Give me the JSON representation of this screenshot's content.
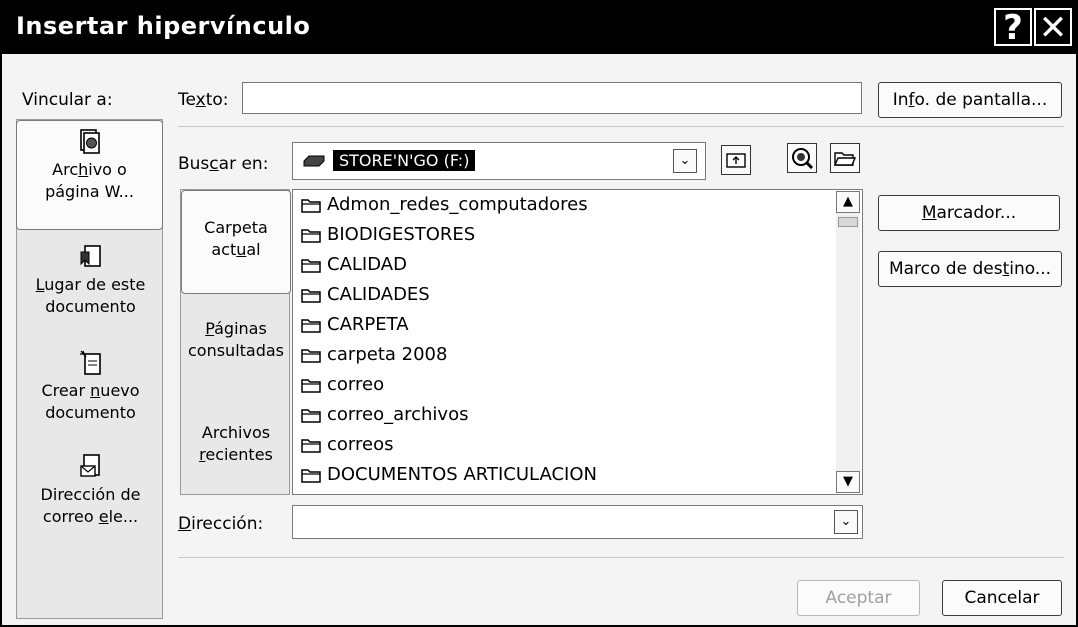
{
  "window": {
    "title": "Insertar hipervínculo",
    "help_glyph": "?",
    "close_glyph": "✕"
  },
  "link_to": {
    "label": "Vincular a:",
    "items": [
      {
        "line1_pre": "Arc",
        "line1_u": "h",
        "line1_post": "ivo o",
        "line2": "página W...",
        "icon": "file-web-icon"
      },
      {
        "line1_pre": "",
        "line1_u": "L",
        "line1_post": "ugar de este",
        "line2": "documento",
        "icon": "bookmark-doc-icon"
      },
      {
        "line1_pre": "Crear ",
        "line1_u": "n",
        "line1_post": "uevo",
        "line2": "documento",
        "icon": "new-document-icon"
      },
      {
        "line1_pre": "Dirección de",
        "line1_u": "",
        "line1_post": "",
        "line2_pre": "correo ",
        "line2_u": "e",
        "line2_post": "le...",
        "icon": "email-icon"
      }
    ]
  },
  "text_field": {
    "label_pre": "Te",
    "label_u": "x",
    "label_post": "to:",
    "value": ""
  },
  "screentip_button": {
    "pre": "In",
    "u": "f",
    "post": "o. de pantalla..."
  },
  "look_in": {
    "label_pre": "Bus",
    "label_u": "c",
    "label_post": "ar en:",
    "value": "STORE'N'GO (F:)",
    "arrow": "⌄"
  },
  "browse_tabs": [
    {
      "line1": "Carpeta",
      "line2_pre": "act",
      "line2_u": "u",
      "line2_post": "al"
    },
    {
      "line1_pre": "",
      "line1_u": "P",
      "line1_post": "áginas",
      "line2": "consultadas"
    },
    {
      "line1": "Archivos",
      "line2_pre": "",
      "line2_u": "r",
      "line2_post": "ecientes"
    }
  ],
  "files": [
    "Admon_redes_computadores",
    "BIODIGESTORES",
    "CALIDAD",
    "CALIDADES",
    "CARPETA",
    "carpeta 2008",
    "correo",
    "correo_archivos",
    "correos",
    "DOCUMENTOS ARTICULACION"
  ],
  "bookmark_button": {
    "pre": "",
    "u": "M",
    "post": "arcador..."
  },
  "target_frame_button": {
    "pre": "Marco de des",
    "u": "t",
    "post": "ino..."
  },
  "address": {
    "label_pre": "",
    "label_u": "D",
    "label_post": "irección:",
    "value": ""
  },
  "ok_button": "Aceptar",
  "cancel_button": "Cancelar"
}
